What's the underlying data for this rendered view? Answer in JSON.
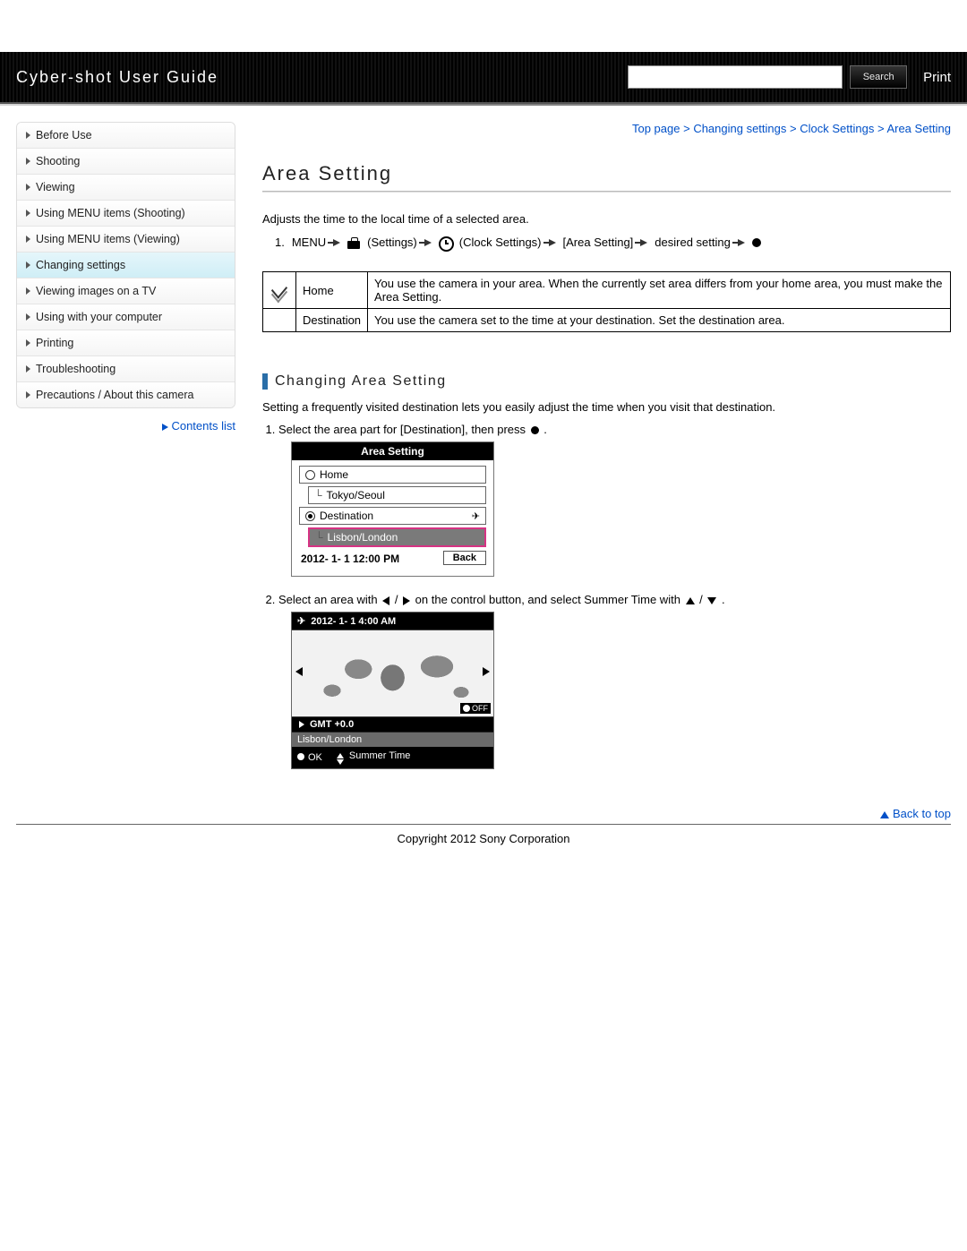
{
  "header": {
    "title": "Cyber-shot User Guide",
    "search_placeholder": "",
    "search_button": "Search",
    "print_button": "Print"
  },
  "sidebar": {
    "items": [
      {
        "label": "Before Use"
      },
      {
        "label": "Shooting"
      },
      {
        "label": "Viewing"
      },
      {
        "label": "Using MENU items (Shooting)"
      },
      {
        "label": "Using MENU items (Viewing)"
      },
      {
        "label": "Changing settings"
      },
      {
        "label": "Viewing images on a TV"
      },
      {
        "label": "Using with your computer"
      },
      {
        "label": "Printing"
      },
      {
        "label": "Troubleshooting"
      },
      {
        "label": "Precautions / About this camera"
      }
    ],
    "active_index": 5,
    "contents_list": "Contents list"
  },
  "breadcrumb": {
    "top": "Top page",
    "a": "Changing settings",
    "b": "Clock Settings",
    "c": "Area Setting",
    "sep": ">"
  },
  "page": {
    "title": "Area Setting",
    "intro": "Adjusts the time to the local time of a selected area.",
    "flow": {
      "num": "1.",
      "menu": "MENU",
      "settings": "(Settings)",
      "clock": "(Clock Settings)",
      "area": "[Area Setting]",
      "desired": "desired setting"
    },
    "table": {
      "rows": [
        {
          "icon": "check",
          "name": "Home",
          "desc": "You use the camera in your area. When the currently set area differs from your home area, you must make the Area Setting."
        },
        {
          "icon": "",
          "name": "Destination",
          "desc": "You use the camera set to the time at your destination. Set the destination area."
        }
      ]
    },
    "subheading": "Changing Area Setting",
    "subtext": "Setting a frequently visited destination lets you easily adjust the time when you visit that destination.",
    "steps": {
      "s1a": "Select the area part for [Destination], then press ",
      "s1b": " .",
      "s2a": "Select an area with ",
      "s2b": " / ",
      "s2c": " on the control button, and select Summer Time with ",
      "s2d": " / ",
      "s2e": " ."
    },
    "cam1": {
      "title": "Area Setting",
      "home": "Home",
      "home_area": "Tokyo/Seoul",
      "dest": "Destination",
      "dest_area": "Lisbon/London",
      "datetime": "2012- 1- 1 12:00 PM",
      "back": "Back"
    },
    "cam2": {
      "top_dt": "2012- 1- 1  4:00 AM",
      "off": "OFF",
      "gmt": "GMT +0.0",
      "area": "Lisbon/London",
      "ok": "OK",
      "summer": "Summer Time"
    }
  },
  "footer": {
    "back_to_top": "Back to top",
    "copyright": "Copyright 2012 Sony Corporation"
  }
}
